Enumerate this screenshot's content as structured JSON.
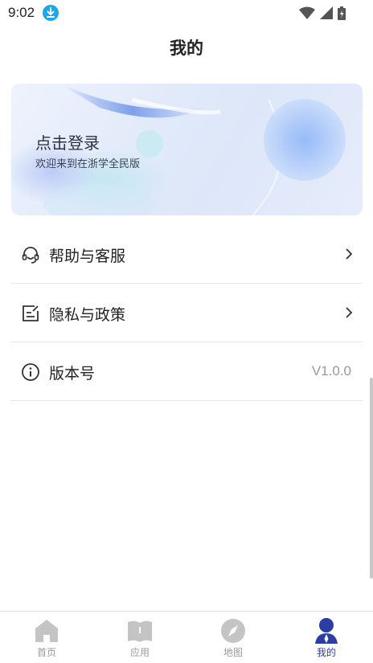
{
  "status_bar": {
    "time": "9:02"
  },
  "header": {
    "title": "我的"
  },
  "banner": {
    "title": "点击登录",
    "subtitle": "欢迎来到在浙学全民版"
  },
  "menu": {
    "items": [
      {
        "label": "帮助与客服",
        "icon": "headset-icon",
        "action": "chevron"
      },
      {
        "label": "隐私与政策",
        "icon": "edit-note-icon",
        "action": "chevron"
      },
      {
        "label": "版本号",
        "icon": "info-icon",
        "value": "V1.0.0"
      }
    ]
  },
  "bottom_nav": {
    "items": [
      {
        "label": "首页",
        "icon": "home-icon",
        "active": false
      },
      {
        "label": "应用",
        "icon": "book-icon",
        "active": false
      },
      {
        "label": "地图",
        "icon": "compass-icon",
        "active": false
      },
      {
        "label": "我的",
        "icon": "person-icon",
        "active": true
      }
    ]
  },
  "colors": {
    "accent": "#2b3ea3",
    "inactive": "#9a9a9a",
    "download_badge": "#1ea7e6"
  }
}
